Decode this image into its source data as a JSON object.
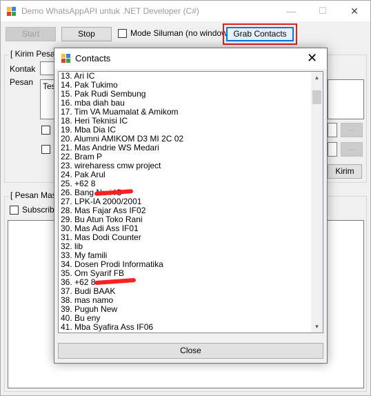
{
  "window": {
    "title": "Demo WhatsAppAPI untuk .NET Developer (C#)",
    "controls": {
      "minimize": "—",
      "maximize": "☐",
      "close": "✕"
    }
  },
  "toolbar": {
    "start_label": "Start",
    "stop_label": "Stop",
    "stealth_label": "Mode Siluman (no window)",
    "grab_label": "Grab Contacts",
    "highlight_color": "#e0201c"
  },
  "send_group": {
    "legend": "[ Kirim Pesan",
    "kontak_label": "Kontak",
    "pesan_label": "Pesan",
    "pesan_value": "Tes",
    "kirim_label": "Kirim",
    "browse_label": "..."
  },
  "inbox_group": {
    "legend": "[ Pesan Masuk",
    "subscribe_label": "Subscribe"
  },
  "dialog": {
    "title": "Contacts",
    "close_label": "Close",
    "contacts": [
      "13. Ari IC",
      "14. Pak Tukimo",
      "15. Pak Rudi Sembung",
      "16. mba diah bau",
      "17. Tim VA Muamalat & Amikom",
      "18. Heri Teknisi IC",
      "19. Mba Dia IC",
      "20. Alumni AMIKOM D3 MI 2C 02",
      "21. Mas Andrie WS Medari",
      "22. Bram P",
      "23. wireharess cmw project",
      "24. Pak Arul",
      "25. +62 8",
      "26. Bang Nuri IC",
      "27. LPK-IA 2000/2001",
      "28. Mas Fajar Ass IF02",
      "29. Bu Atun Toko Rani",
      "30. Mas Adi Ass IF01",
      "31. Mas Dodi Counter",
      "32. lib",
      "33. My famili",
      "34. Dosen Prodi Informatika",
      "35. Om Syarif FB",
      "36. +62 8",
      "37. Budi BAAK",
      "38. mas namo",
      "39. Puguh New",
      "40. Bu eny",
      "41. Mba Syafira Ass IF06"
    ]
  }
}
